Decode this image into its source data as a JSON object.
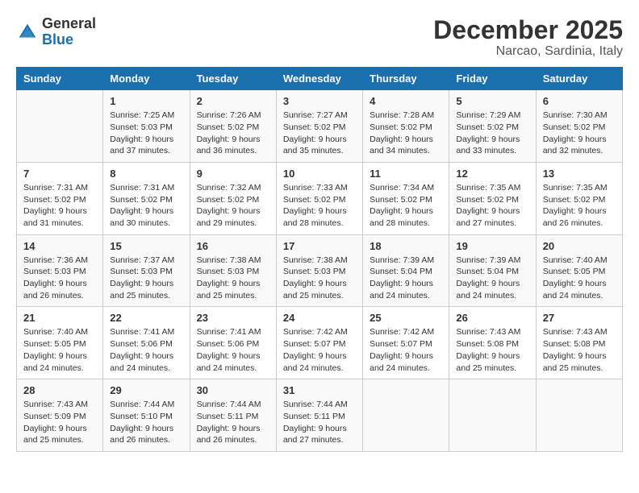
{
  "header": {
    "logo_general": "General",
    "logo_blue": "Blue",
    "month_title": "December 2025",
    "subtitle": "Narcao, Sardinia, Italy"
  },
  "weekdays": [
    "Sunday",
    "Monday",
    "Tuesday",
    "Wednesday",
    "Thursday",
    "Friday",
    "Saturday"
  ],
  "weeks": [
    [
      {
        "day": "",
        "info": ""
      },
      {
        "day": "1",
        "info": "Sunrise: 7:25 AM\nSunset: 5:03 PM\nDaylight: 9 hours\nand 37 minutes."
      },
      {
        "day": "2",
        "info": "Sunrise: 7:26 AM\nSunset: 5:02 PM\nDaylight: 9 hours\nand 36 minutes."
      },
      {
        "day": "3",
        "info": "Sunrise: 7:27 AM\nSunset: 5:02 PM\nDaylight: 9 hours\nand 35 minutes."
      },
      {
        "day": "4",
        "info": "Sunrise: 7:28 AM\nSunset: 5:02 PM\nDaylight: 9 hours\nand 34 minutes."
      },
      {
        "day": "5",
        "info": "Sunrise: 7:29 AM\nSunset: 5:02 PM\nDaylight: 9 hours\nand 33 minutes."
      },
      {
        "day": "6",
        "info": "Sunrise: 7:30 AM\nSunset: 5:02 PM\nDaylight: 9 hours\nand 32 minutes."
      }
    ],
    [
      {
        "day": "7",
        "info": "Sunrise: 7:31 AM\nSunset: 5:02 PM\nDaylight: 9 hours\nand 31 minutes."
      },
      {
        "day": "8",
        "info": "Sunrise: 7:31 AM\nSunset: 5:02 PM\nDaylight: 9 hours\nand 30 minutes."
      },
      {
        "day": "9",
        "info": "Sunrise: 7:32 AM\nSunset: 5:02 PM\nDaylight: 9 hours\nand 29 minutes."
      },
      {
        "day": "10",
        "info": "Sunrise: 7:33 AM\nSunset: 5:02 PM\nDaylight: 9 hours\nand 28 minutes."
      },
      {
        "day": "11",
        "info": "Sunrise: 7:34 AM\nSunset: 5:02 PM\nDaylight: 9 hours\nand 28 minutes."
      },
      {
        "day": "12",
        "info": "Sunrise: 7:35 AM\nSunset: 5:02 PM\nDaylight: 9 hours\nand 27 minutes."
      },
      {
        "day": "13",
        "info": "Sunrise: 7:35 AM\nSunset: 5:02 PM\nDaylight: 9 hours\nand 26 minutes."
      }
    ],
    [
      {
        "day": "14",
        "info": "Sunrise: 7:36 AM\nSunset: 5:03 PM\nDaylight: 9 hours\nand 26 minutes."
      },
      {
        "day": "15",
        "info": "Sunrise: 7:37 AM\nSunset: 5:03 PM\nDaylight: 9 hours\nand 25 minutes."
      },
      {
        "day": "16",
        "info": "Sunrise: 7:38 AM\nSunset: 5:03 PM\nDaylight: 9 hours\nand 25 minutes."
      },
      {
        "day": "17",
        "info": "Sunrise: 7:38 AM\nSunset: 5:03 PM\nDaylight: 9 hours\nand 25 minutes."
      },
      {
        "day": "18",
        "info": "Sunrise: 7:39 AM\nSunset: 5:04 PM\nDaylight: 9 hours\nand 24 minutes."
      },
      {
        "day": "19",
        "info": "Sunrise: 7:39 AM\nSunset: 5:04 PM\nDaylight: 9 hours\nand 24 minutes."
      },
      {
        "day": "20",
        "info": "Sunrise: 7:40 AM\nSunset: 5:05 PM\nDaylight: 9 hours\nand 24 minutes."
      }
    ],
    [
      {
        "day": "21",
        "info": "Sunrise: 7:40 AM\nSunset: 5:05 PM\nDaylight: 9 hours\nand 24 minutes."
      },
      {
        "day": "22",
        "info": "Sunrise: 7:41 AM\nSunset: 5:06 PM\nDaylight: 9 hours\nand 24 minutes."
      },
      {
        "day": "23",
        "info": "Sunrise: 7:41 AM\nSunset: 5:06 PM\nDaylight: 9 hours\nand 24 minutes."
      },
      {
        "day": "24",
        "info": "Sunrise: 7:42 AM\nSunset: 5:07 PM\nDaylight: 9 hours\nand 24 minutes."
      },
      {
        "day": "25",
        "info": "Sunrise: 7:42 AM\nSunset: 5:07 PM\nDaylight: 9 hours\nand 24 minutes."
      },
      {
        "day": "26",
        "info": "Sunrise: 7:43 AM\nSunset: 5:08 PM\nDaylight: 9 hours\nand 25 minutes."
      },
      {
        "day": "27",
        "info": "Sunrise: 7:43 AM\nSunset: 5:08 PM\nDaylight: 9 hours\nand 25 minutes."
      }
    ],
    [
      {
        "day": "28",
        "info": "Sunrise: 7:43 AM\nSunset: 5:09 PM\nDaylight: 9 hours\nand 25 minutes."
      },
      {
        "day": "29",
        "info": "Sunrise: 7:44 AM\nSunset: 5:10 PM\nDaylight: 9 hours\nand 26 minutes."
      },
      {
        "day": "30",
        "info": "Sunrise: 7:44 AM\nSunset: 5:11 PM\nDaylight: 9 hours\nand 26 minutes."
      },
      {
        "day": "31",
        "info": "Sunrise: 7:44 AM\nSunset: 5:11 PM\nDaylight: 9 hours\nand 27 minutes."
      },
      {
        "day": "",
        "info": ""
      },
      {
        "day": "",
        "info": ""
      },
      {
        "day": "",
        "info": ""
      }
    ]
  ]
}
